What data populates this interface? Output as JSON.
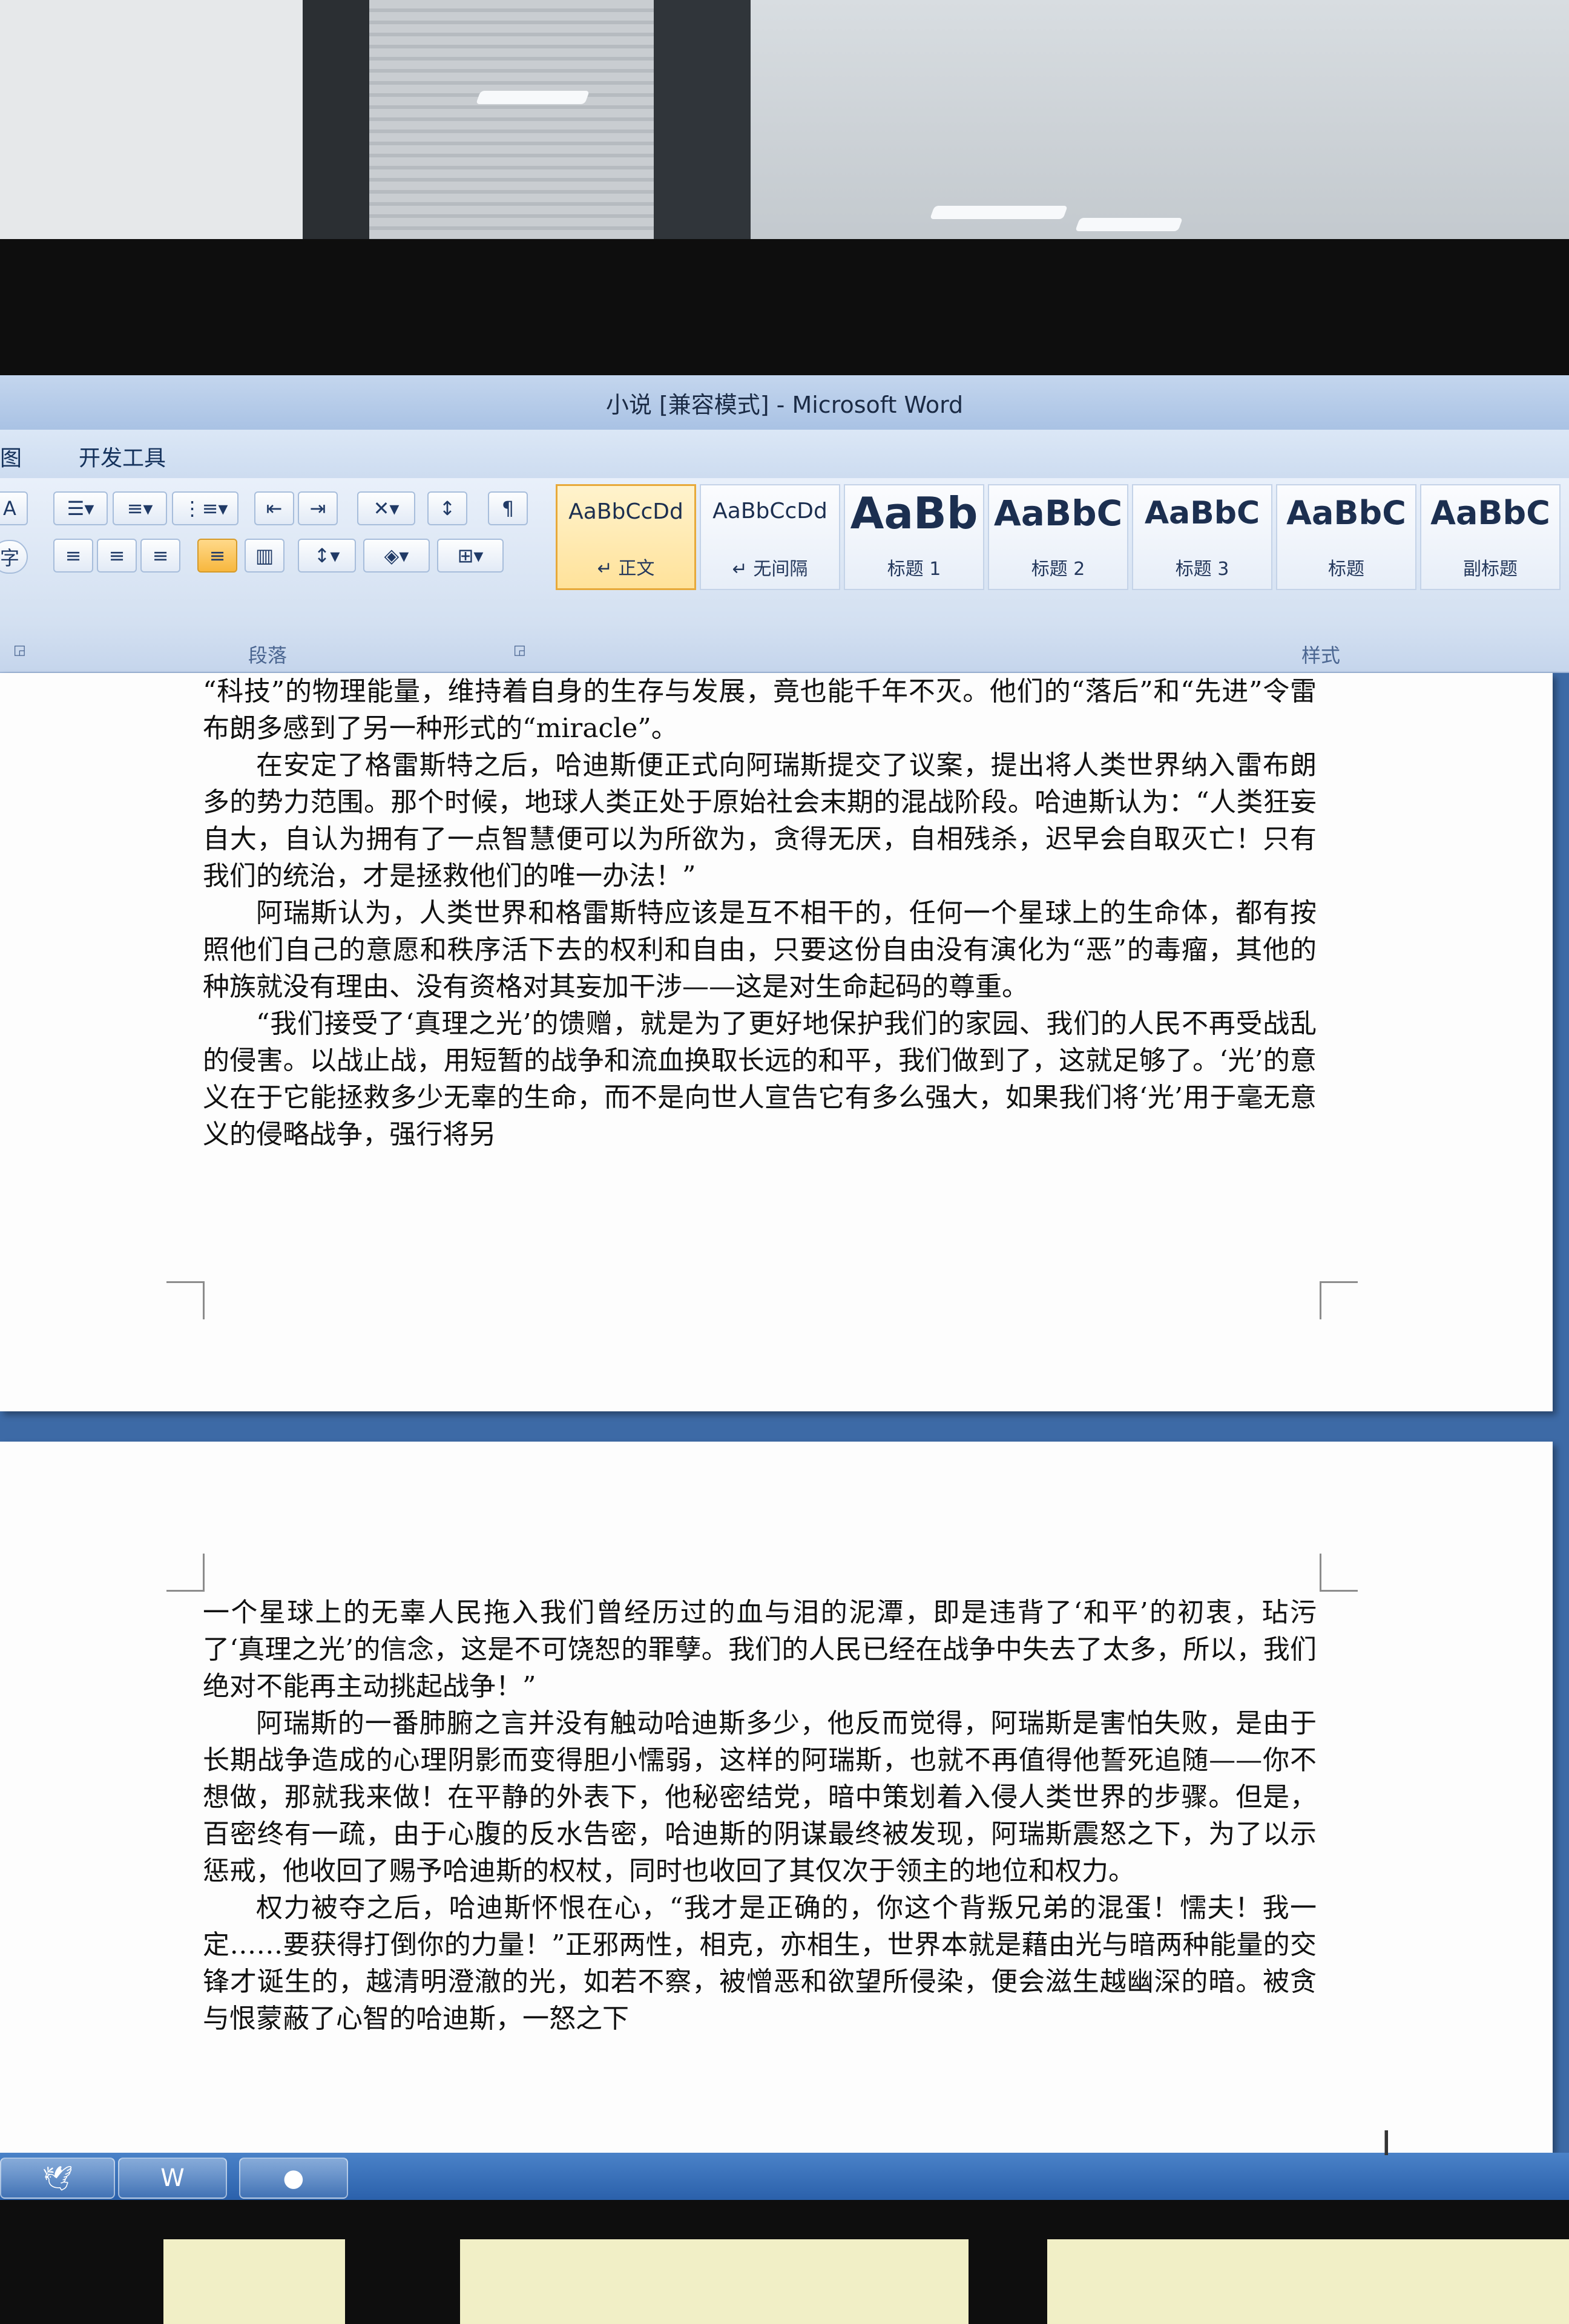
{
  "window": {
    "title": "小说 [兼容模式] - Microsoft Word"
  },
  "menubar": {
    "partial_tab": "图",
    "dev_tools": "开发工具"
  },
  "ribbon": {
    "paragraph_group_label": "段落",
    "styles_group_label": "样式",
    "styles": [
      {
        "sample": "AaBbCcDd",
        "name": "↵ 正文",
        "selected": true
      },
      {
        "sample": "AaBbCcDd",
        "name": "↵ 无间隔",
        "selected": false
      },
      {
        "sample": "AaBb",
        "name": "标题 1",
        "selected": false
      },
      {
        "sample": "AaBbC",
        "name": "标题 2",
        "selected": false
      },
      {
        "sample": "AaBbC",
        "name": "标题 3",
        "selected": false
      },
      {
        "sample": "AaBbC",
        "name": "标题",
        "selected": false
      },
      {
        "sample": "AaBbC",
        "name": "副标题",
        "selected": false
      }
    ]
  },
  "document": {
    "page1": [
      {
        "indent": false,
        "text": "“科技”的物理能量，维持着自身的生存与发展，竟也能千年不灭。他们的“落后”和“先进”令雷布朗多感到了另一种形式的“miracle”。"
      },
      {
        "indent": true,
        "text": "在安定了格雷斯特之后，哈迪斯便正式向阿瑞斯提交了议案，提出将人类世界纳入雷布朗多的势力范围。那个时候，地球人类正处于原始社会末期的混战阶段。哈迪斯认为：“人类狂妄自大，自认为拥有了一点智慧便可以为所欲为，贪得无厌，自相残杀，迟早会自取灭亡！只有我们的统治，才是拯救他们的唯一办法！”"
      },
      {
        "indent": true,
        "text": "阿瑞斯认为，人类世界和格雷斯特应该是互不相干的，任何一个星球上的生命体，都有按照他们自己的意愿和秩序活下去的权利和自由，只要这份自由没有演化为“恶”的毒瘤，其他的种族就没有理由、没有资格对其妄加干涉——这是对生命起码的尊重。"
      },
      {
        "indent": true,
        "text": "“我们接受了‘真理之光’的馈赠，就是为了更好地保护我们的家园、我们的人民不再受战乱的侵害。以战止战，用短暂的战争和流血换取长远的和平，我们做到了，这就足够了。‘光’的意义在于它能拯救多少无辜的生命，而不是向世人宣告它有多么强大，如果我们将‘光’用于毫无意义的侵略战争，强行将另"
      }
    ],
    "page2": [
      {
        "indent": false,
        "text": "一个星球上的无辜人民拖入我们曾经历过的血与泪的泥潭，即是违背了‘和平’的初衷，玷污了‘真理之光’的信念，这是不可饶恕的罪孽。我们的人民已经在战争中失去了太多，所以，我们绝对不能再主动挑起战争！”"
      },
      {
        "indent": true,
        "text": "阿瑞斯的一番肺腑之言并没有触动哈迪斯多少，他反而觉得，阿瑞斯是害怕失败，是由于长期战争造成的心理阴影而变得胆小懦弱，这样的阿瑞斯，也就不再值得他誓死追随——你不想做，那就我来做！在平静的外表下，他秘密结党，暗中策划着入侵人类世界的步骤。但是，百密终有一疏，由于心腹的反水告密，哈迪斯的阴谋最终被发现，阿瑞斯震怒之下，为了以示惩戒，他收回了赐予哈迪斯的权杖，同时也收回了其仅次于领主的地位和权力。"
      },
      {
        "indent": true,
        "text": "权力被夺之后，哈迪斯怀恨在心，“我才是正确的，你这个背叛兄弟的混蛋！懦夫！我一定……要获得打倒你的力量！”正邪两性，相克，亦相生，世界本就是藉由光与暗两种能量的交锋才诞生的，越清明澄澈的光，如若不察，被憎恶和欲望所侵染，便会滋生越幽深的暗。被贪与恨蒙蔽了心智的哈迪斯，一怒之下"
      }
    ]
  },
  "colors": {
    "accent": "#3d6aa6",
    "selected_style": "#e7a93a",
    "taskbar": "#2b61ab"
  }
}
